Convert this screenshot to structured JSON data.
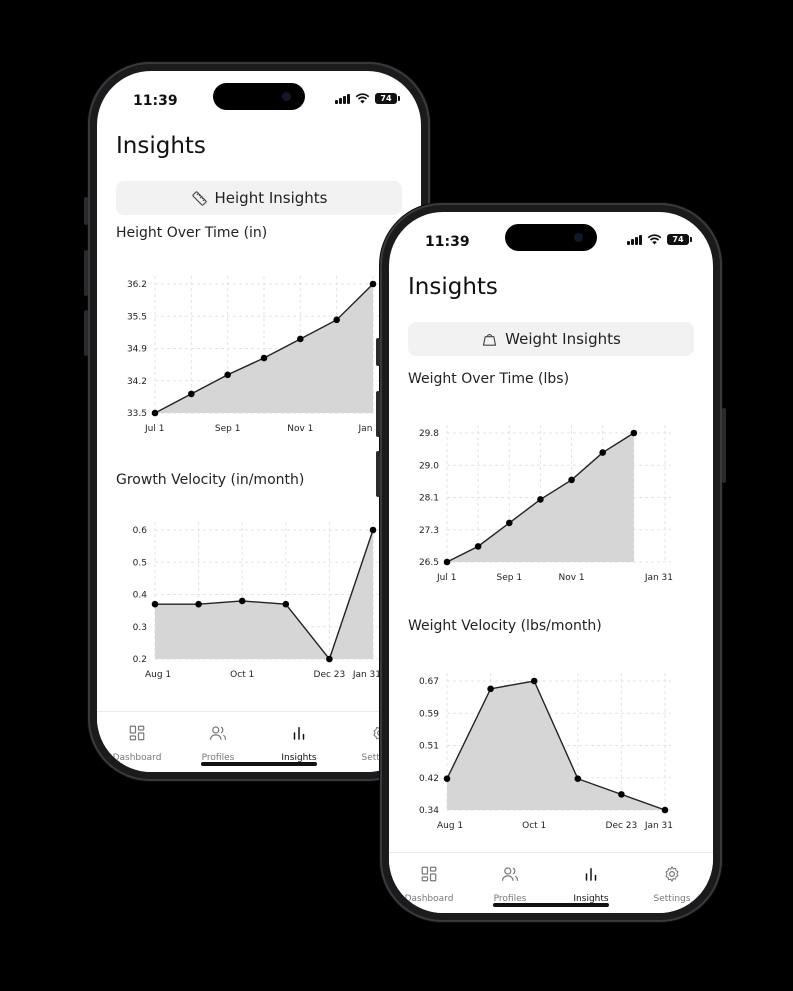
{
  "status": {
    "time": "11:39",
    "battery": "74"
  },
  "nav_tabs": [
    {
      "label": "Dashboard",
      "icon": "grid-icon"
    },
    {
      "label": "Profiles",
      "icon": "users-icon"
    },
    {
      "label": "Insights",
      "icon": "bar-chart-icon"
    },
    {
      "label": "Settings",
      "icon": "gear-icon"
    }
  ],
  "phone1": {
    "title": "Insights",
    "segment": {
      "label": "Height Insights",
      "icon": "ruler-icon"
    },
    "chart1_title": "Height Over Time (in)",
    "chart2_title": "Growth Velocity (in/month)"
  },
  "phone2": {
    "title": "Insights",
    "segment": {
      "label": "Weight Insights",
      "icon": "weight-icon"
    },
    "chart1_title": "Weight Over Time (lbs)",
    "chart2_title": "Weight Velocity (lbs/month)"
  },
  "chart_data": [
    {
      "type": "area",
      "title": "Height Over Time (in)",
      "x": [
        "Jul 1",
        "Aug 1",
        "Sep 1",
        "Oct 1",
        "Nov 1",
        "Dec 1",
        "Jan 1"
      ],
      "y": [
        33.5,
        33.9,
        34.3,
        34.65,
        35.05,
        35.45,
        36.2
      ],
      "xticks": [
        "Jul 1",
        "Sep 1",
        "Nov 1",
        "Jan 1"
      ],
      "ylim": [
        33.5,
        36.2
      ],
      "yticks": [
        "33.5",
        "34.2",
        "34.9",
        "35.5",
        "36.2"
      ],
      "grid": true
    },
    {
      "type": "area",
      "title": "Growth Velocity (in/month)",
      "x": [
        "Aug 1",
        "Sep 1",
        "Oct 1",
        "Nov 1",
        "Dec 23",
        "Jan 31"
      ],
      "y": [
        0.37,
        0.37,
        0.38,
        0.37,
        0.2,
        0.6
      ],
      "xticks": [
        "Aug 1",
        "Oct 1",
        "Dec 23",
        "Jan 31"
      ],
      "ylim": [
        0.2,
        0.6
      ],
      "yticks": [
        "0.2",
        "0.3",
        "0.4",
        "0.5",
        "0.6"
      ],
      "grid": true
    },
    {
      "type": "area",
      "title": "Weight Over Time (lbs)",
      "x": [
        "Jul 1",
        "Aug 1",
        "Sep 1",
        "Oct 1",
        "Nov 1",
        "Dec 1",
        "Jan 1",
        "Jan 31"
      ],
      "y": [
        26.5,
        26.9,
        27.5,
        28.1,
        28.6,
        29.3,
        29.8
      ],
      "xticks": [
        "Jul 1",
        "Sep 1",
        "Nov 1",
        "Jan 31"
      ],
      "ylim": [
        26.5,
        29.8
      ],
      "yticks": [
        "26.5",
        "27.3",
        "28.1",
        "29.0",
        "29.8"
      ],
      "grid": true
    },
    {
      "type": "area",
      "title": "Weight Velocity (lbs/month)",
      "x": [
        "Aug 1",
        "Sep 1",
        "Oct 1",
        "Nov 1",
        "Dec 23",
        "Jan 31"
      ],
      "y": [
        0.42,
        0.65,
        0.67,
        0.42,
        0.38,
        0.34
      ],
      "xticks": [
        "Aug 1",
        "Oct 1",
        "Dec 23",
        "Jan 31"
      ],
      "ylim": [
        0.34,
        0.67
      ],
      "yticks": [
        "0.34",
        "0.42",
        "0.51",
        "0.59",
        "0.67"
      ],
      "grid": true
    }
  ]
}
